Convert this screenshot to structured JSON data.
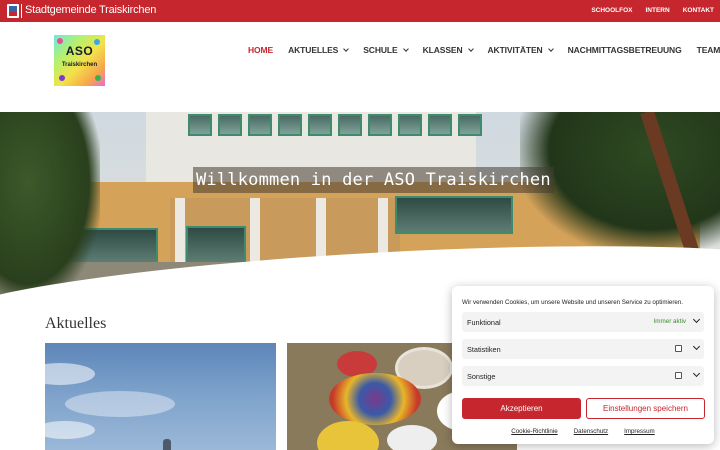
{
  "topbar": {
    "brand": "Stadtgemeinde Traiskirchen",
    "links": [
      "SCHOOLFOX",
      "INTERN",
      "KONTAKT"
    ],
    "color": "#c6262e"
  },
  "logo": {
    "line1": "ASO",
    "line2": "Traiskirchen"
  },
  "nav": {
    "items": [
      {
        "label": "HOME",
        "active": true,
        "dropdown": false
      },
      {
        "label": "AKTUELLES",
        "dropdown": true
      },
      {
        "label": "SCHULE",
        "dropdown": true
      },
      {
        "label": "KLASSEN",
        "dropdown": true
      },
      {
        "label": "AKTIVITÄTEN",
        "dropdown": true
      },
      {
        "label": "NACHMITTAGSBETREUUNG",
        "dropdown": false
      },
      {
        "label": "TEAM",
        "dropdown": true
      }
    ]
  },
  "hero": {
    "title": "Willkommen in der ASO Traiskirchen"
  },
  "main": {
    "section_title": "Aktuelles"
  },
  "cookie": {
    "intro": "Wir verwenden Cookies, um unsere Website und unseren Service zu optimieren.",
    "rows": [
      {
        "label": "Funktional",
        "status": "Immer aktiv"
      },
      {
        "label": "Statistiken",
        "status": ""
      },
      {
        "label": "Sonstige",
        "status": ""
      }
    ],
    "accept_label": "Akzeptieren",
    "settings_label": "Einstellungen speichern",
    "footer_links": [
      "Cookie-Richtlinie",
      "Datenschutz",
      "Impressum"
    ]
  }
}
